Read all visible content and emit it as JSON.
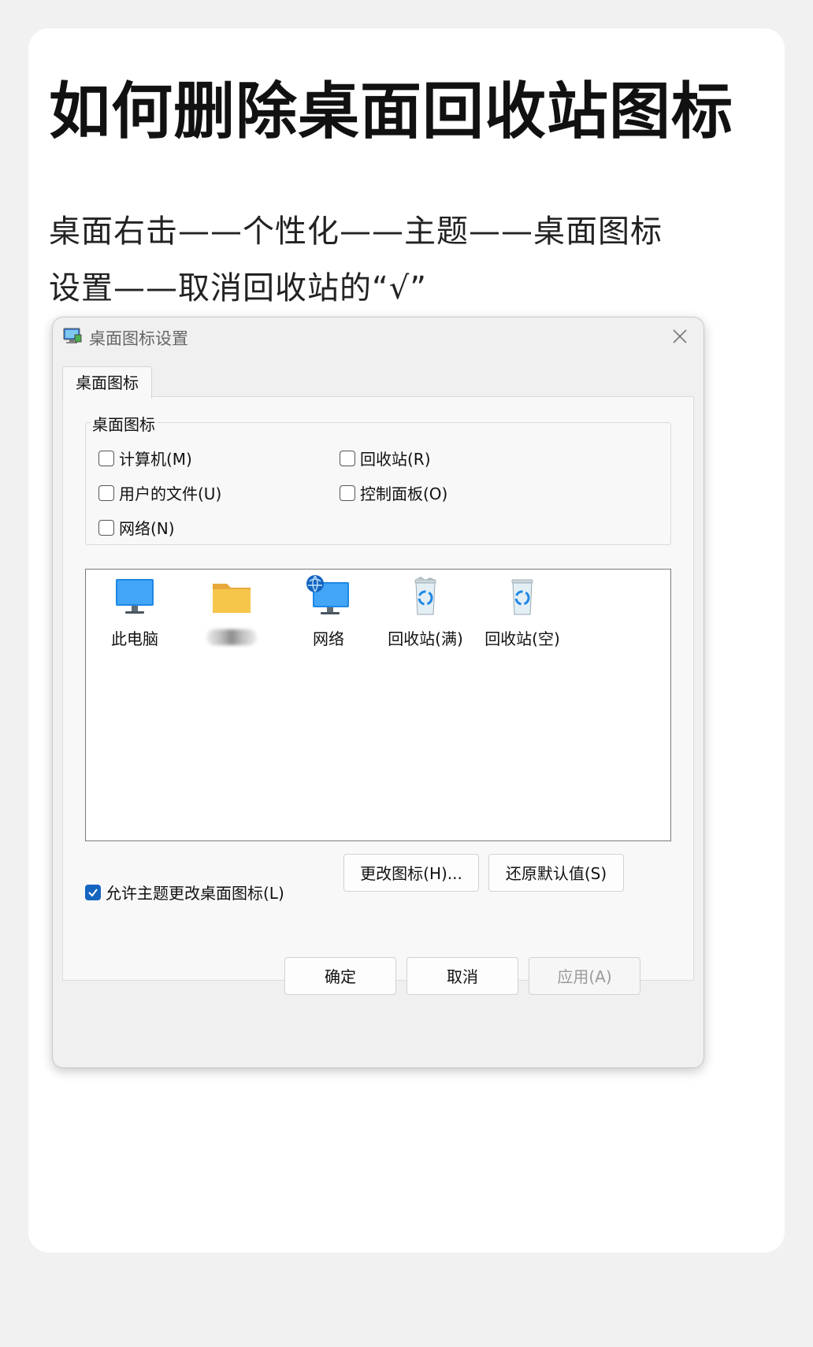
{
  "article": {
    "title": "如何删除桌面回收站图标",
    "steps_line1": "桌面右击——个性化——主题——桌面图标",
    "steps_line2": "设置——取消回收站的“√”"
  },
  "dialog": {
    "title": "桌面图标设置",
    "tab_label": "桌面图标",
    "group_label": "桌面图标",
    "checkboxes": [
      {
        "label": "计算机(M)",
        "checked": false
      },
      {
        "label": "回收站(R)",
        "checked": false
      },
      {
        "label": "用户的文件(U)",
        "checked": false
      },
      {
        "label": "控制面板(O)",
        "checked": false
      },
      {
        "label": "网络(N)",
        "checked": false
      }
    ],
    "icons": [
      {
        "label": "此电脑",
        "icon": "monitor-icon"
      },
      {
        "label": "",
        "icon": "folder-icon"
      },
      {
        "label": "网络",
        "icon": "network-icon"
      },
      {
        "label": "回收站(满)",
        "icon": "recycle-bin-full-icon"
      },
      {
        "label": "回收站(空)",
        "icon": "recycle-bin-empty-icon"
      }
    ],
    "change_icon_button": "更改图标(H)...",
    "restore_default_button": "还原默认值(S)",
    "allow_theme": {
      "label": "允许主题更改桌面图标(L)",
      "checked": true
    },
    "ok_button": "确定",
    "cancel_button": "取消",
    "apply_button": "应用(A)"
  },
  "colors": {
    "accent": "#1565c0",
    "monitor": "#1e88e5",
    "folder": "#f6c64b"
  }
}
